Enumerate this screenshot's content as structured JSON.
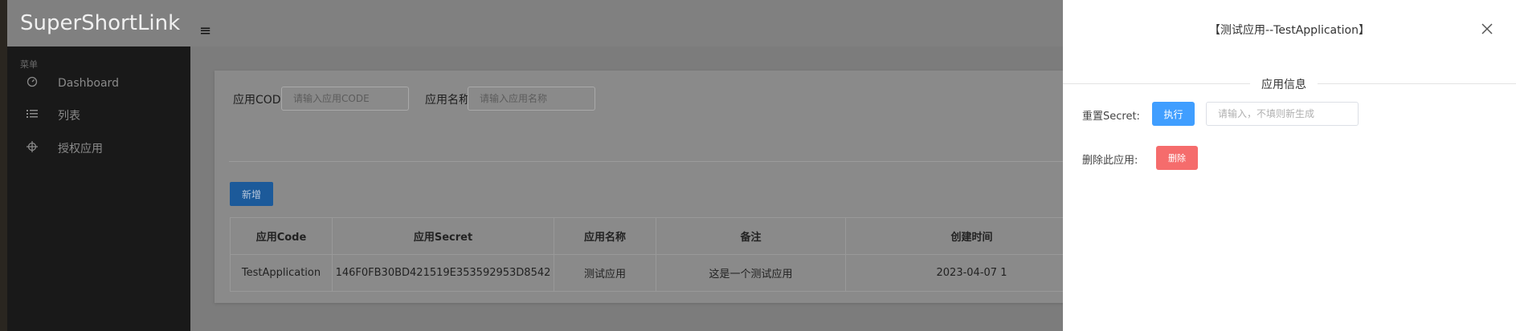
{
  "app": {
    "logo": "SuperShortLink",
    "menu_icon": "hamburger-icon"
  },
  "sidebar": {
    "caption": "菜单",
    "items": [
      {
        "label": "Dashboard",
        "icon": "speedometer-icon"
      },
      {
        "label": "列表",
        "icon": "list-icon"
      },
      {
        "label": "授权应用",
        "icon": "crosshair-icon"
      }
    ]
  },
  "search": {
    "code_label": "应用CODE",
    "code_placeholder": "请输入应用CODE",
    "name_label": "应用名称",
    "name_placeholder": "请输入应用名称"
  },
  "toolbar": {
    "add_label": "新增"
  },
  "table": {
    "headers": [
      "应用Code",
      "应用Secret",
      "应用名称",
      "备注",
      "创建时间"
    ],
    "rows": [
      [
        "TestApplication",
        "146F0FB30BD421519E353592953D8542",
        "测试应用",
        "这是一个测试应用",
        "2023-04-07 1"
      ]
    ]
  },
  "drawer": {
    "title": "【测试应用--TestApplication】",
    "section_title": "应用信息",
    "reset_label": "重置Secret:",
    "exec_label": "执行",
    "secret_placeholder": "请输入，不填则新生成",
    "delete_label": "删除此应用:",
    "delete_button": "删除"
  },
  "colors": {
    "primary": "#409eff",
    "danger": "#f56c6c",
    "sidebar_bg": "#191919",
    "mask": "#7c7c7c"
  }
}
